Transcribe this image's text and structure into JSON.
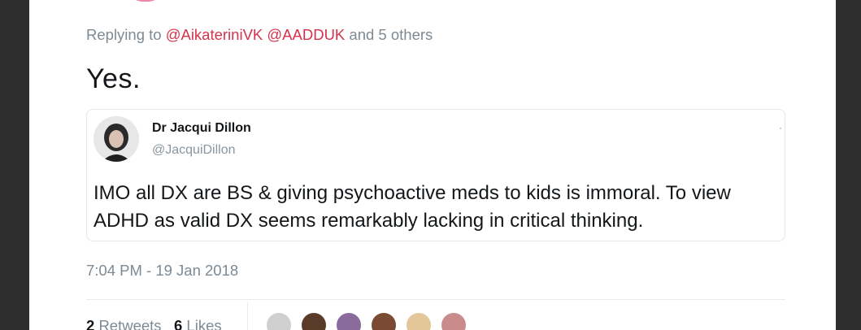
{
  "reply": {
    "prefix": "Replying to",
    "mentions": [
      "@AikateriniVK",
      "@AADDUK"
    ],
    "suffix": "and 5 others"
  },
  "tweet": {
    "text": "Yes."
  },
  "quoted_tweet": {
    "author_name": "Dr Jacqui Dillon",
    "author_handle": "@JacquiDillon",
    "text": "IMO all DX are BS & giving psychoactive meds to kids is immoral. To view ADHD as valid DX seems remarkably lacking in critical thinking."
  },
  "timestamp": "7:04 PM - 19 Jan 2018",
  "stats": {
    "retweets_count": "2",
    "retweets_label": "Retweets",
    "likes_count": "6",
    "likes_label": "Likes"
  },
  "liker_avatars": [
    {
      "color": "#cfcfcf"
    },
    {
      "color": "#5a3b2a"
    },
    {
      "color": "#8a6b9c"
    },
    {
      "color": "#7a4a33"
    },
    {
      "color": "#e3c79a"
    },
    {
      "color": "#c98b8b"
    }
  ]
}
